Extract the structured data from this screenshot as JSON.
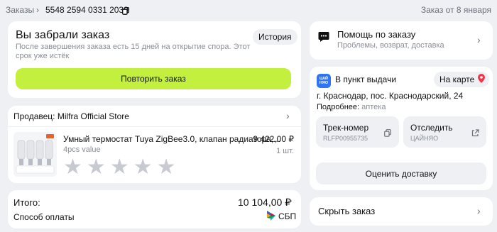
{
  "breadcrumb": {
    "root": "Заказы",
    "order_number": "5548 2594 0331 2030",
    "date": "Заказ от 8 января"
  },
  "status": {
    "title": "Вы забрали заказ",
    "text_line1": "После завершения заказа есть 15 дней на открытие спора. Этот",
    "text_line2": "срок уже истёк",
    "history_label": "История",
    "repeat_label": "Повторить заказ"
  },
  "seller": {
    "label": "Продавец: Milfra Official Store",
    "item": {
      "name": "Умный термостат Tuya ZigBee3.0, клапан радиатора,...",
      "variant": "4pcs value",
      "price": "9 422,00 ₽",
      "qty": "1 шт.",
      "rating_stars": 5
    }
  },
  "total": {
    "label": "Итого:",
    "amount": "10 104,00 ₽",
    "payment_label": "Способ оплаты",
    "payment_method": "СБП"
  },
  "help": {
    "title": "Помощь по заказу",
    "subtitle": "Проблемы, возврат, доставка"
  },
  "pickup": {
    "logo_line1": "ЦАЙ",
    "logo_line2": "НЯО",
    "title": "В пункт выдачи",
    "map_label": "На карте",
    "address": "г. Краснодар, пос. Краснодарский, 24",
    "details_label": "Подробнее:",
    "details_value": "аптека",
    "track_label": "Трек-номер",
    "track_value": "RLFP00955735",
    "follow_label": "Отследить",
    "follow_value": "ЦАЙНЯО",
    "rate_label": "Оценить доставку"
  },
  "hide": {
    "label": "Скрыть заказ"
  },
  "colors": {
    "accent_green": "#c3ef3f",
    "map_pin": "#f0364a",
    "logo_blue": "#2f74f5",
    "background": "#eef0f4"
  }
}
